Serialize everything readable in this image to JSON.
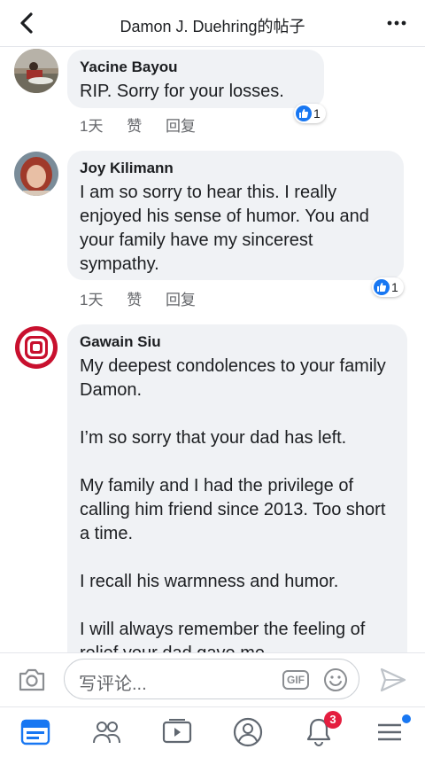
{
  "header": {
    "title": "Damon J. Duehring的帖子"
  },
  "comments": [
    {
      "author": "Yacine Bayou",
      "text": "RIP. Sorry for your losses.",
      "time": "1天",
      "like_label": "赞",
      "reply_label": "回复",
      "reaction_count": "1"
    },
    {
      "author": "Joy Kilimann",
      "text": "I am so sorry to hear this. I really enjoyed his  sense of humor.  You and your family have my sincerest sympathy.",
      "time": "1天",
      "like_label": "赞",
      "reply_label": "回复",
      "reaction_count": "1"
    },
    {
      "author": "Gawain Siu",
      "text": "My deepest condolences to your family Damon.\n\nI’m so sorry that your dad has left.\n\nMy family and I had the privilege of calling him friend since 2013. Too short a time.\n\nI recall his warmness and humor.\n\nI will always remember the feeling of relief your dad gave me"
    }
  ],
  "composer": {
    "placeholder": "写评论...",
    "gif_label": "GIF"
  },
  "tabbar": {
    "notifications_badge": "3"
  },
  "colors": {
    "accent": "#1877f2",
    "badge": "#e41e3f",
    "bubble": "#f0f2f5"
  }
}
